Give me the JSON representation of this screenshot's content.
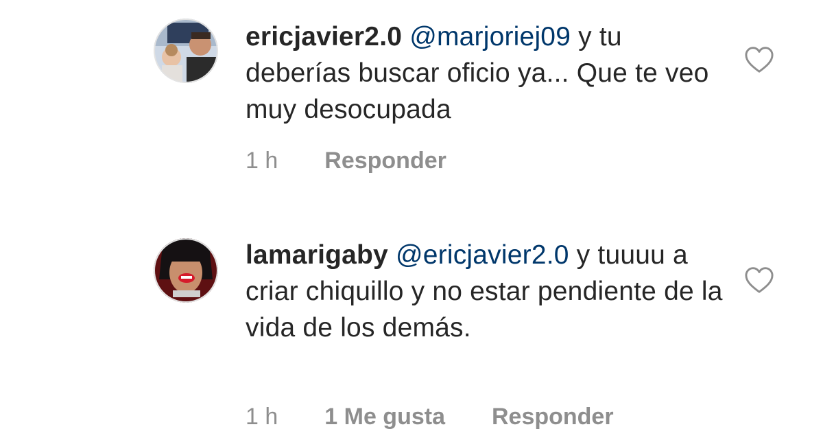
{
  "comments": [
    {
      "username": "ericjavier2.0",
      "mention": "@marjoriej09",
      "text": " y tu deberías buscar oficio ya... Que te veo muy desocupada",
      "time": "1 h",
      "reply_label": "Responder",
      "like_icon": "heart-outline-icon",
      "avatar_icon": "avatar-photo"
    },
    {
      "username": "lamarigaby",
      "mention": "@ericjavier2.0",
      "text": " y tuuuu a criar chiquillo y no estar pendiente de la vida de los demás.",
      "time": "1 h",
      "likes_label": "1 Me gusta",
      "reply_label": "Responder",
      "like_icon": "heart-outline-icon",
      "avatar_icon": "avatar-photo"
    }
  ],
  "colors": {
    "text": "#262626",
    "mention": "#00376b",
    "meta": "#8e8e8e",
    "heart_outline": "#8e8e8e"
  }
}
